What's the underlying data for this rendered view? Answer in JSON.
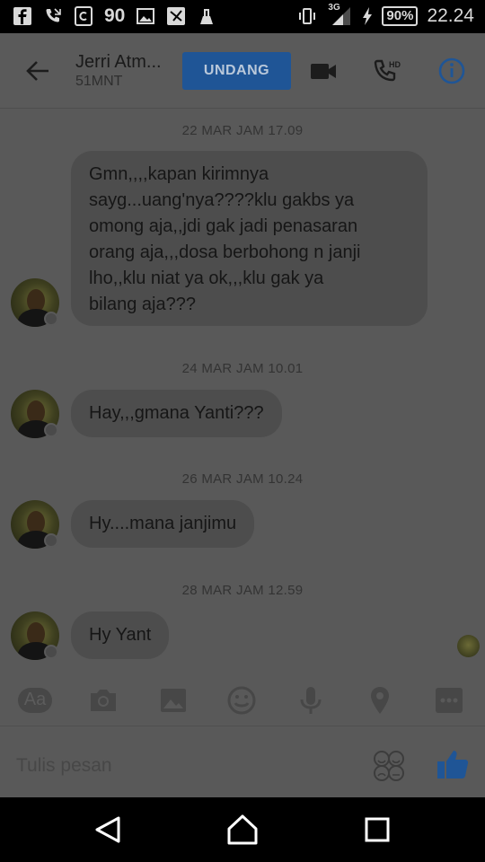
{
  "status_bar": {
    "notif_count": "90",
    "network": "3G",
    "battery": "90%",
    "time": "22.24"
  },
  "header": {
    "contact_name": "Jerri Atm...",
    "contact_status": "51MNT",
    "invite_label": "UNDANG"
  },
  "conversation": [
    {
      "timestamp": "22 MAR JAM 17.09",
      "lines": [
        "Gmn,,,,kapan kirimnya",
        "sayg...uang'nya????klu gakbs ya",
        "omong aja,,jdi gak jadi penasaran",
        "orang aja,,,dosa berbohong n janji",
        "lho,,klu niat ya ok,,,klu gak ya",
        "bilang aja???"
      ]
    },
    {
      "timestamp": "24 MAR JAM 10.01",
      "lines": [
        "Hay,,,gmana Yanti???"
      ]
    },
    {
      "timestamp": "26 MAR JAM 10.24",
      "lines": [
        "Hy....mana janjimu"
      ]
    },
    {
      "timestamp": "28 MAR JAM 12.59",
      "lines": [
        "Hy Yant"
      ]
    }
  ],
  "composer": {
    "aa_label": "Aa",
    "placeholder": "Tulis pesan"
  },
  "icons": {
    "back": "arrow-left-icon",
    "video": "video-camera-icon",
    "call": "hd-phone-icon",
    "info": "info-icon",
    "like": "thumbs-up-icon"
  },
  "colors": {
    "accent": "#1f5596",
    "dim_overlay": "#595959",
    "bubble": "#4d4d4d"
  }
}
